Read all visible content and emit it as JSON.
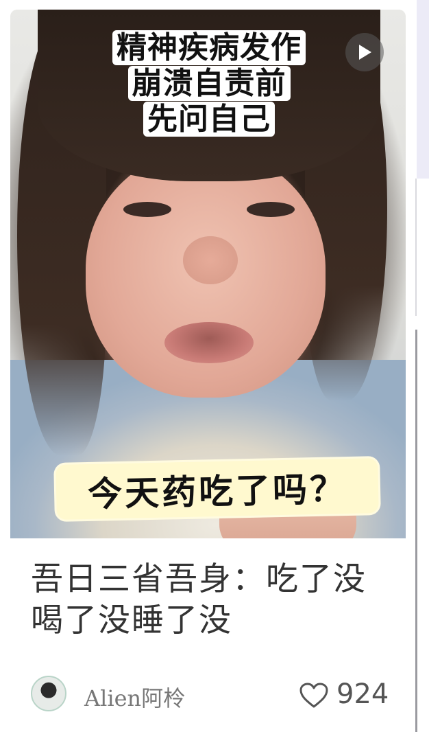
{
  "card": {
    "overlay_title_lines": [
      "精神疾病发作",
      "崩溃自责前",
      "先问自己"
    ],
    "overlay_question": "今天药吃了吗？",
    "caption": "吾日三省吾身：吃了没喝了没睡了没",
    "author": "Alien阿柃",
    "likes": "924",
    "icons": {
      "play": "play-icon",
      "like": "heart-outline-icon",
      "avatar": "user-avatar"
    }
  }
}
